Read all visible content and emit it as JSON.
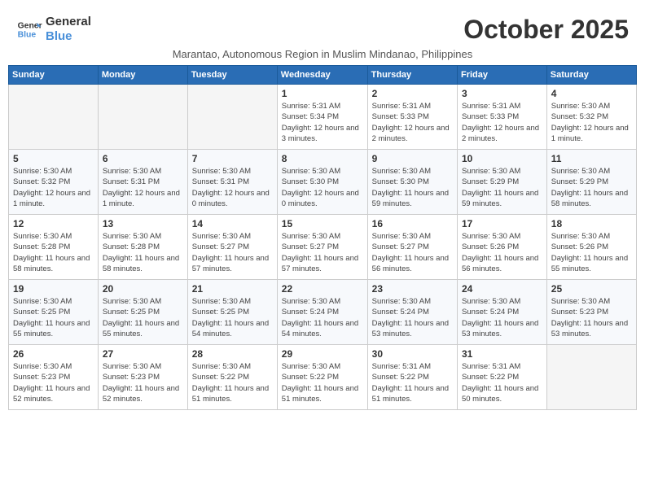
{
  "header": {
    "logo_line1": "General",
    "logo_line2": "Blue",
    "month_title": "October 2025",
    "subtitle": "Marantao, Autonomous Region in Muslim Mindanao, Philippines"
  },
  "days_of_week": [
    "Sunday",
    "Monday",
    "Tuesday",
    "Wednesday",
    "Thursday",
    "Friday",
    "Saturday"
  ],
  "weeks": [
    [
      {
        "day": "",
        "info": ""
      },
      {
        "day": "",
        "info": ""
      },
      {
        "day": "",
        "info": ""
      },
      {
        "day": "1",
        "info": "Sunrise: 5:31 AM\nSunset: 5:34 PM\nDaylight: 12 hours and 3 minutes."
      },
      {
        "day": "2",
        "info": "Sunrise: 5:31 AM\nSunset: 5:33 PM\nDaylight: 12 hours and 2 minutes."
      },
      {
        "day": "3",
        "info": "Sunrise: 5:31 AM\nSunset: 5:33 PM\nDaylight: 12 hours and 2 minutes."
      },
      {
        "day": "4",
        "info": "Sunrise: 5:30 AM\nSunset: 5:32 PM\nDaylight: 12 hours and 1 minute."
      }
    ],
    [
      {
        "day": "5",
        "info": "Sunrise: 5:30 AM\nSunset: 5:32 PM\nDaylight: 12 hours and 1 minute."
      },
      {
        "day": "6",
        "info": "Sunrise: 5:30 AM\nSunset: 5:31 PM\nDaylight: 12 hours and 1 minute."
      },
      {
        "day": "7",
        "info": "Sunrise: 5:30 AM\nSunset: 5:31 PM\nDaylight: 12 hours and 0 minutes."
      },
      {
        "day": "8",
        "info": "Sunrise: 5:30 AM\nSunset: 5:30 PM\nDaylight: 12 hours and 0 minutes."
      },
      {
        "day": "9",
        "info": "Sunrise: 5:30 AM\nSunset: 5:30 PM\nDaylight: 11 hours and 59 minutes."
      },
      {
        "day": "10",
        "info": "Sunrise: 5:30 AM\nSunset: 5:29 PM\nDaylight: 11 hours and 59 minutes."
      },
      {
        "day": "11",
        "info": "Sunrise: 5:30 AM\nSunset: 5:29 PM\nDaylight: 11 hours and 58 minutes."
      }
    ],
    [
      {
        "day": "12",
        "info": "Sunrise: 5:30 AM\nSunset: 5:28 PM\nDaylight: 11 hours and 58 minutes."
      },
      {
        "day": "13",
        "info": "Sunrise: 5:30 AM\nSunset: 5:28 PM\nDaylight: 11 hours and 58 minutes."
      },
      {
        "day": "14",
        "info": "Sunrise: 5:30 AM\nSunset: 5:27 PM\nDaylight: 11 hours and 57 minutes."
      },
      {
        "day": "15",
        "info": "Sunrise: 5:30 AM\nSunset: 5:27 PM\nDaylight: 11 hours and 57 minutes."
      },
      {
        "day": "16",
        "info": "Sunrise: 5:30 AM\nSunset: 5:27 PM\nDaylight: 11 hours and 56 minutes."
      },
      {
        "day": "17",
        "info": "Sunrise: 5:30 AM\nSunset: 5:26 PM\nDaylight: 11 hours and 56 minutes."
      },
      {
        "day": "18",
        "info": "Sunrise: 5:30 AM\nSunset: 5:26 PM\nDaylight: 11 hours and 55 minutes."
      }
    ],
    [
      {
        "day": "19",
        "info": "Sunrise: 5:30 AM\nSunset: 5:25 PM\nDaylight: 11 hours and 55 minutes."
      },
      {
        "day": "20",
        "info": "Sunrise: 5:30 AM\nSunset: 5:25 PM\nDaylight: 11 hours and 55 minutes."
      },
      {
        "day": "21",
        "info": "Sunrise: 5:30 AM\nSunset: 5:25 PM\nDaylight: 11 hours and 54 minutes."
      },
      {
        "day": "22",
        "info": "Sunrise: 5:30 AM\nSunset: 5:24 PM\nDaylight: 11 hours and 54 minutes."
      },
      {
        "day": "23",
        "info": "Sunrise: 5:30 AM\nSunset: 5:24 PM\nDaylight: 11 hours and 53 minutes."
      },
      {
        "day": "24",
        "info": "Sunrise: 5:30 AM\nSunset: 5:24 PM\nDaylight: 11 hours and 53 minutes."
      },
      {
        "day": "25",
        "info": "Sunrise: 5:30 AM\nSunset: 5:23 PM\nDaylight: 11 hours and 53 minutes."
      }
    ],
    [
      {
        "day": "26",
        "info": "Sunrise: 5:30 AM\nSunset: 5:23 PM\nDaylight: 11 hours and 52 minutes."
      },
      {
        "day": "27",
        "info": "Sunrise: 5:30 AM\nSunset: 5:23 PM\nDaylight: 11 hours and 52 minutes."
      },
      {
        "day": "28",
        "info": "Sunrise: 5:30 AM\nSunset: 5:22 PM\nDaylight: 11 hours and 51 minutes."
      },
      {
        "day": "29",
        "info": "Sunrise: 5:30 AM\nSunset: 5:22 PM\nDaylight: 11 hours and 51 minutes."
      },
      {
        "day": "30",
        "info": "Sunrise: 5:31 AM\nSunset: 5:22 PM\nDaylight: 11 hours and 51 minutes."
      },
      {
        "day": "31",
        "info": "Sunrise: 5:31 AM\nSunset: 5:22 PM\nDaylight: 11 hours and 50 minutes."
      },
      {
        "day": "",
        "info": ""
      }
    ]
  ]
}
